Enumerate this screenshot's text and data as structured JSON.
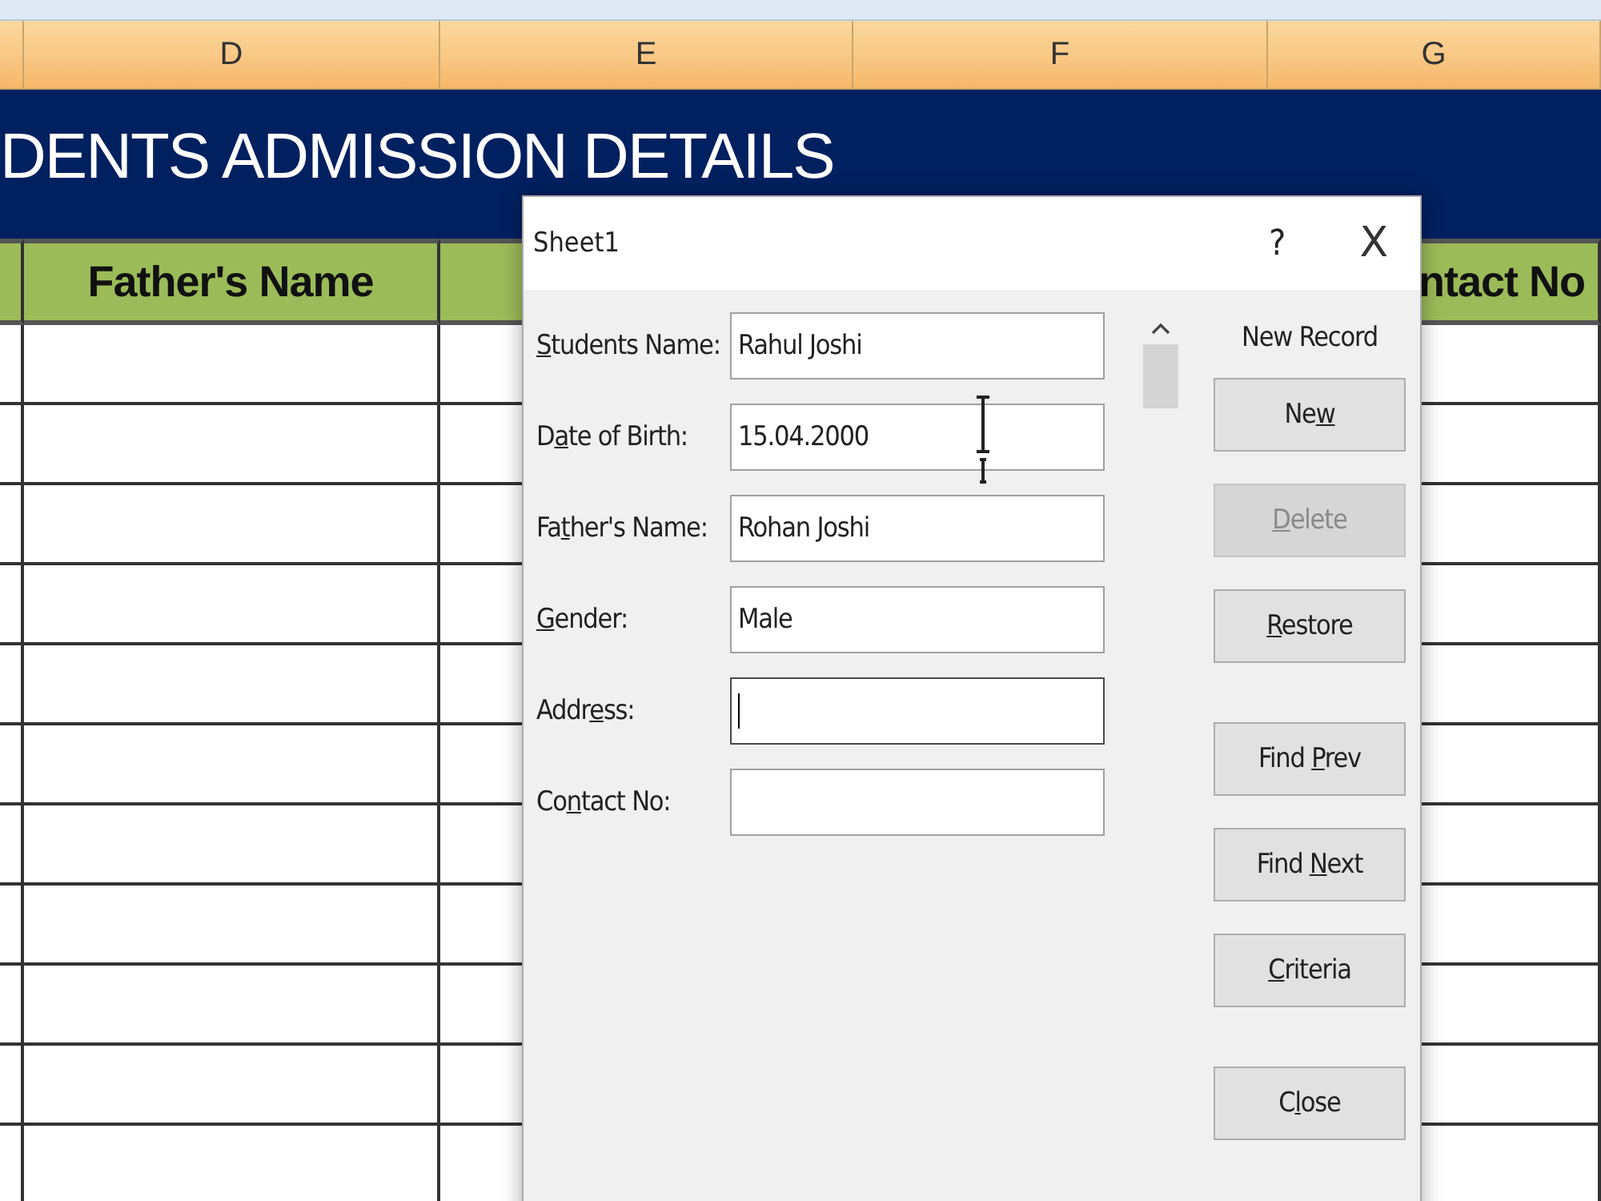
{
  "sheet": {
    "column_letters": [
      "D",
      "E",
      "F",
      "G"
    ],
    "title": "DENTS ADMISSION DETAILS",
    "header_row": {
      "column_d": "Father's Name",
      "column_g": "ntact No"
    }
  },
  "dialog": {
    "title": "Sheet1",
    "help": "?",
    "close": "X",
    "fields": [
      {
        "label": {
          "key": "S",
          "post": "tudents Name:"
        },
        "value": "Rahul Joshi",
        "focused": false
      },
      {
        "label": {
          "pre": "D",
          "key": "a",
          "post": "te of Birth:"
        },
        "value": "15.04.2000",
        "focused": false
      },
      {
        "label": {
          "pre": "Fa",
          "key": "t",
          "post": "her's Name:"
        },
        "value": "Rohan Joshi",
        "focused": false
      },
      {
        "label": {
          "key": "G",
          "post": "ender:"
        },
        "value": "Male",
        "focused": false
      },
      {
        "label": {
          "pre": "Addr",
          "key": "e",
          "post": "ss:"
        },
        "focused": true
      },
      {
        "label": {
          "pre": "Co",
          "key": "n",
          "post": "tact No:"
        },
        "focused": false
      }
    ],
    "record_status": "New Record",
    "button_groups": [
      [
        {
          "label": {
            "pre": "Ne",
            "key": "w"
          },
          "disabled": false
        },
        {
          "label": {
            "key": "D",
            "post": "elete"
          },
          "disabled": true
        },
        {
          "label": {
            "key": "R",
            "post": "estore"
          },
          "disabled": false
        }
      ],
      [
        {
          "label": {
            "pre": "Find ",
            "key": "P",
            "post": "rev"
          },
          "disabled": false
        },
        {
          "label": {
            "pre": "Find ",
            "key": "N",
            "post": "ext"
          },
          "disabled": false
        },
        {
          "label": {
            "key": "C",
            "post": "riteria"
          },
          "disabled": false
        }
      ],
      [
        {
          "label": {
            "pre": "C",
            "key": "l",
            "post": "ose"
          },
          "disabled": false
        }
      ]
    ]
  }
}
